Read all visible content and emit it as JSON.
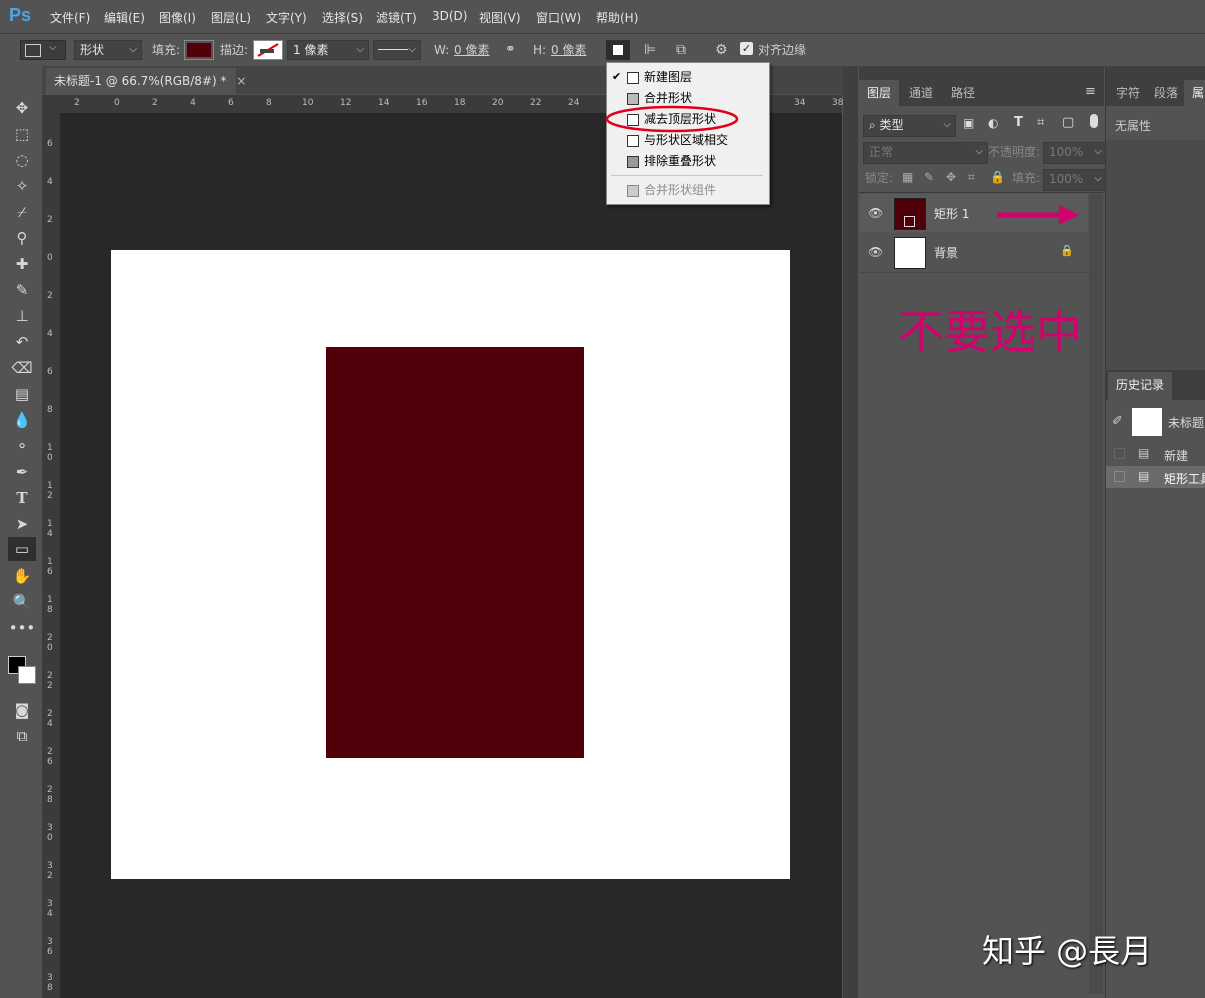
{
  "app": {
    "logo": "Ps"
  },
  "menubar": [
    "文件(F)",
    "编辑(E)",
    "图像(I)",
    "图层(L)",
    "文字(Y)",
    "选择(S)",
    "滤镜(T)",
    "3D(D)",
    "视图(V)",
    "窗口(W)",
    "帮助(H)"
  ],
  "options": {
    "mode": "形状",
    "fill_label": "填充:",
    "fill_color": "#51000a",
    "stroke_label": "描边:",
    "stroke_width": "1 像素",
    "w_label": "W:",
    "w_value": "0 像素",
    "h_label": "H:",
    "h_value": "0 像素",
    "align_edges": "对齐边缘"
  },
  "document": {
    "tab": "未标题-1 @ 66.7%(RGB/8#) *",
    "close": "×",
    "shape_color": "#51000a"
  },
  "ruler_h": [
    "2",
    "0",
    "2",
    "4",
    "6",
    "8",
    "10",
    "12",
    "14",
    "16",
    "18",
    "20",
    "22",
    "24",
    "34",
    "36",
    "38"
  ],
  "ruler_v": [
    "6",
    "4",
    "2",
    "0",
    "2",
    "4",
    "6",
    "8",
    "1 0",
    "1 2",
    "1 4",
    "1 6",
    "1 8",
    "2 0",
    "2 2",
    "2 4",
    "2 6",
    "2 8",
    "3 0",
    "3 2",
    "3 4",
    "3 6",
    "3 8"
  ],
  "path_ops_menu": {
    "items": [
      {
        "label": "新建图层",
        "checked": true,
        "disabled": false
      },
      {
        "label": "合并形状",
        "checked": false,
        "disabled": false
      },
      {
        "label": "减去顶层形状",
        "checked": false,
        "disabled": false,
        "highlighted": true
      },
      {
        "label": "与形状区域相交",
        "checked": false,
        "disabled": false
      },
      {
        "label": "排除重叠形状",
        "checked": false,
        "disabled": false
      },
      {
        "label": "合并形状组件",
        "checked": false,
        "disabled": true
      }
    ],
    "check_mark": "✔"
  },
  "layers_panel": {
    "tabs": [
      "图层",
      "通道",
      "路径"
    ],
    "filter": "类型",
    "blend_mode": "正常",
    "opacity_label": "不透明度:",
    "opacity": "100%",
    "lock_label": "锁定:",
    "fill_label": "填充:",
    "fill": "100%",
    "layers": [
      {
        "name": "矩形 1",
        "thumb": "#51000a"
      },
      {
        "name": "背景",
        "thumb": "#ffffff"
      }
    ]
  },
  "annotation": {
    "text": "不要选中",
    "color": "#d4006e"
  },
  "props_panel": {
    "tabs": [
      "字符",
      "段落",
      "属"
    ],
    "content": "无属性"
  },
  "history_panel": {
    "tab": "历史记录",
    "snapshot": "未标题",
    "items": [
      "新建",
      "矩形工具"
    ]
  },
  "watermark": "知乎 @長月"
}
